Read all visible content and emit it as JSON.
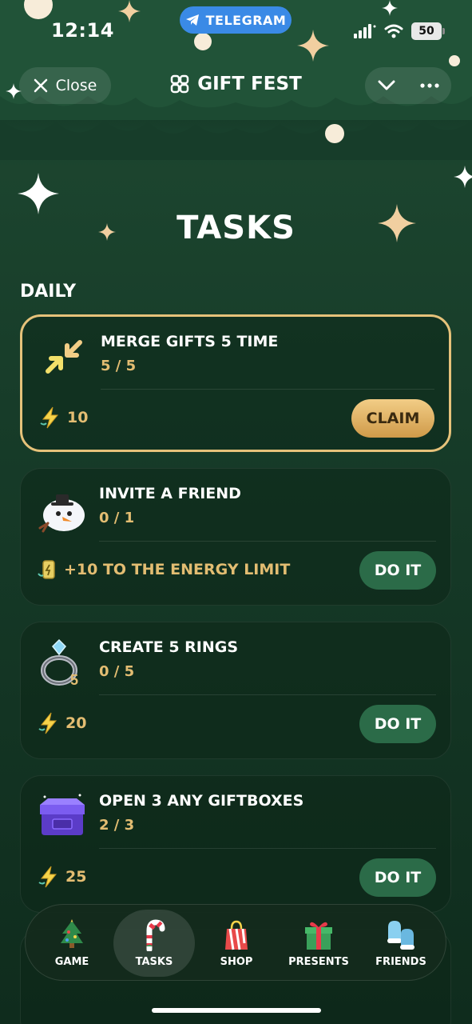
{
  "status_bar": {
    "time": "12:14",
    "telegram_label": "TELEGRAM",
    "battery": "50"
  },
  "header": {
    "close_label": "Close",
    "title": "GIFT FEST"
  },
  "page": {
    "title": "TASKS",
    "section": "DAILY"
  },
  "tasks": [
    {
      "name": "MERGE GIFTS 5 TIME",
      "progress": "5 / 5",
      "reward": "10",
      "reward_icon": "lightning-icon",
      "button": "CLAIM",
      "status": "completed",
      "icon": "merge-arrows-icon"
    },
    {
      "name": "INVITE A FRIEND",
      "progress": "0 / 1",
      "reward": "+10 TO THE ENERGY LIMIT",
      "reward_icon": "energy-drink-icon",
      "button": "DO IT",
      "status": "pending",
      "icon": "snowman-icon"
    },
    {
      "name": "CREATE 5 RINGS",
      "progress": "0 / 5",
      "reward": "20",
      "reward_icon": "lightning-icon",
      "button": "DO IT",
      "status": "pending",
      "icon": "ring-icon",
      "icon_badge": "5"
    },
    {
      "name": "OPEN 3 ANY GIFTBOXES",
      "progress": "2 / 3",
      "reward": "25",
      "reward_icon": "lightning-icon",
      "button": "DO IT",
      "status": "pending",
      "icon": "giftbox-icon"
    }
  ],
  "bottom_nav": [
    {
      "label": "GAME",
      "icon": "christmas-tree-icon",
      "active": false
    },
    {
      "label": "TASKS",
      "icon": "candy-cane-icon",
      "active": true
    },
    {
      "label": "SHOP",
      "icon": "shopping-bag-icon",
      "active": false
    },
    {
      "label": "PRESENTS",
      "icon": "present-icon",
      "active": false
    },
    {
      "label": "FRIENDS",
      "icon": "mittens-icon",
      "active": false
    }
  ],
  "colors": {
    "background": "#173c29",
    "gold": "#e3bd72",
    "claim_button": "#e0b46a",
    "do_it_button": "#2b6b48",
    "telegram": "#3a8ae6"
  }
}
